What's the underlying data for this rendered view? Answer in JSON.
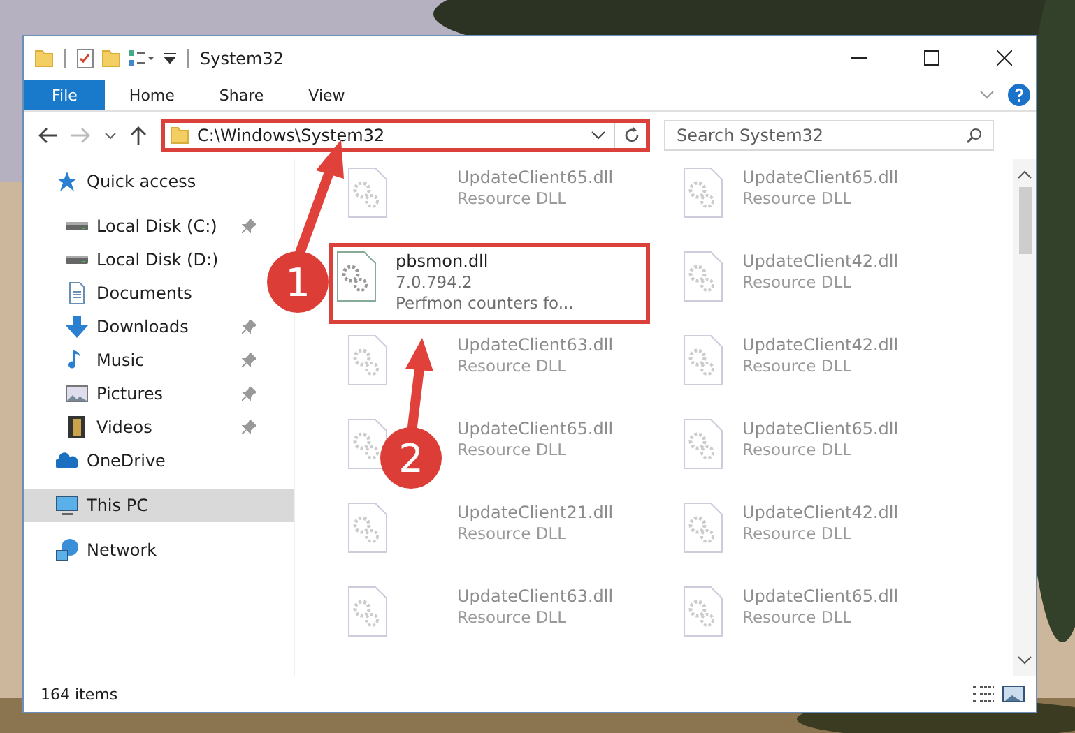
{
  "window": {
    "title": "System32"
  },
  "ribbon_tabs": [
    {
      "label": "File",
      "selected": true
    },
    {
      "label": "Home",
      "selected": false
    },
    {
      "label": "Share",
      "selected": false
    },
    {
      "label": "View",
      "selected": false
    }
  ],
  "address": {
    "value": "C:\\Windows\\System32"
  },
  "search": {
    "placeholder": "Search System32"
  },
  "sidebar": {
    "items": [
      {
        "label": "Quick access",
        "kind": "star",
        "selected": false,
        "children": [
          {
            "label": "Local Disk (C:)",
            "kind": "disk",
            "pinned": true,
            "selected": false
          },
          {
            "label": "Local Disk (D:)",
            "kind": "disk",
            "pinned": false,
            "selected": false
          },
          {
            "label": "Documents",
            "kind": "doc",
            "pinned": false,
            "selected": false
          },
          {
            "label": "Downloads",
            "kind": "download",
            "pinned": true,
            "selected": false
          },
          {
            "label": "Music",
            "kind": "music",
            "pinned": true,
            "selected": false
          },
          {
            "label": "Pictures",
            "kind": "pictures",
            "pinned": true,
            "selected": false
          },
          {
            "label": "Videos",
            "kind": "videos",
            "pinned": true,
            "selected": false
          }
        ]
      },
      {
        "label": "OneDrive",
        "kind": "cloud",
        "selected": false
      },
      {
        "label": "This PC",
        "kind": "pc",
        "selected": true
      },
      {
        "label": "Network",
        "kind": "network",
        "selected": false
      }
    ]
  },
  "files": [
    {
      "name": "UpdateClient65.dll",
      "detail": "Resource DLL",
      "blurred": true,
      "highlighted": false
    },
    {
      "name": "UpdateClient65.dll",
      "detail": "Resource DLL",
      "blurred": true,
      "highlighted": false
    },
    {
      "name": "pbsmon.dll",
      "version": "7.0.794.2",
      "detail": "Perfmon counters fo...",
      "blurred": false,
      "highlighted": true
    },
    {
      "name": "UpdateClient42.dll",
      "detail": "Resource DLL",
      "blurred": true,
      "highlighted": false
    },
    {
      "name": "UpdateClient63.dll",
      "detail": "Resource DLL",
      "blurred": true,
      "highlighted": false
    },
    {
      "name": "UpdateClient42.dll",
      "detail": "Resource DLL",
      "blurred": true,
      "highlighted": false
    },
    {
      "name": "UpdateClient65.dll",
      "detail": "Resource DLL",
      "blurred": true,
      "highlighted": false
    },
    {
      "name": "UpdateClient65.dll",
      "detail": "Resource DLL",
      "blurred": true,
      "highlighted": false
    },
    {
      "name": "UpdateClient21.dll",
      "detail": "Resource DLL",
      "blurred": true,
      "highlighted": false
    },
    {
      "name": "UpdateClient42.dll",
      "detail": "Resource DLL",
      "blurred": true,
      "highlighted": false
    },
    {
      "name": "UpdateClient63.dll",
      "detail": "Resource DLL",
      "blurred": true,
      "highlighted": false
    },
    {
      "name": "UpdateClient65.dll",
      "detail": "Resource DLL",
      "blurred": true,
      "highlighted": false
    }
  ],
  "status_bar": {
    "count": "164 items"
  },
  "annotations": {
    "address_highlighted": true,
    "steps": [
      "1",
      "2"
    ]
  }
}
